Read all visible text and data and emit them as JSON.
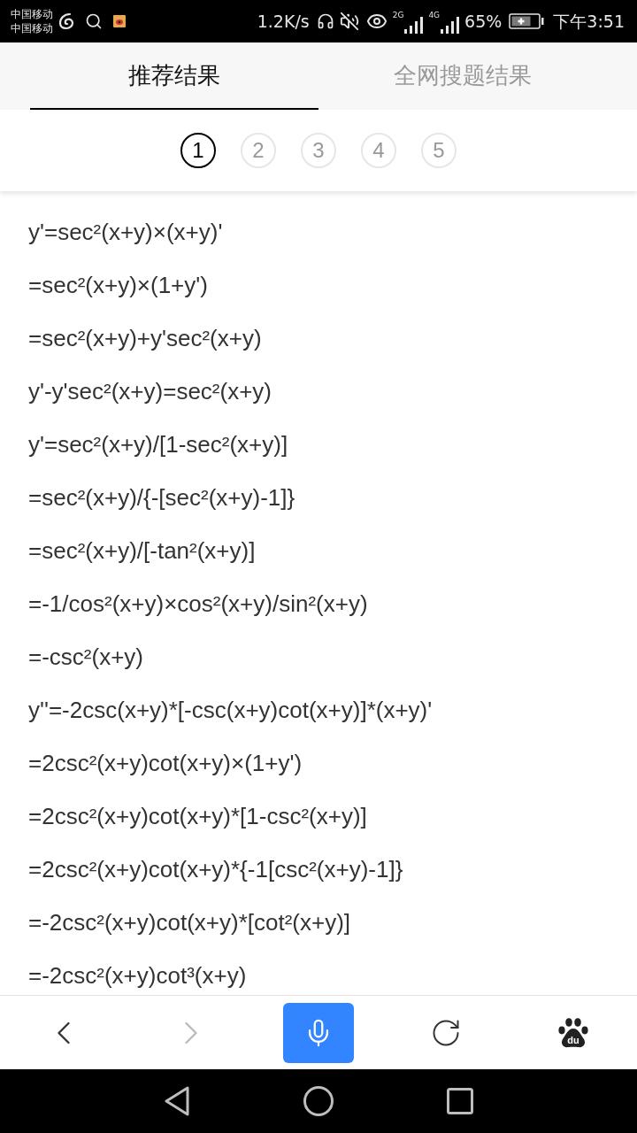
{
  "status_bar": {
    "carriers": [
      "中国移动",
      "中国移动"
    ],
    "speed": "1.2K/s",
    "networks": [
      "2G",
      "4G"
    ],
    "battery": "65%",
    "time": "下午3:51"
  },
  "tabs": [
    {
      "label": "推荐结果",
      "selected": true
    },
    {
      "label": "全网搜题结果",
      "selected": false
    }
  ],
  "pagination": [
    {
      "label": "1",
      "selected": true
    },
    {
      "label": "2",
      "selected": false
    },
    {
      "label": "3",
      "selected": false
    },
    {
      "label": "4",
      "selected": false
    },
    {
      "label": "5",
      "selected": false
    }
  ],
  "solution_lines": [
    "y'=sec²(x+y)×(x+y)'",
    "=sec²(x+y)×(1+y')",
    "=sec²(x+y)+y'sec²(x+y)",
    "y'-y'sec²(x+y)=sec²(x+y)",
    "y'=sec²(x+y)/[1-sec²(x+y)]",
    "=sec²(x+y)/{-[sec²(x+y)-1]}",
    "=sec²(x+y)/[-tan²(x+y)]",
    "=-1/cos²(x+y)×cos²(x+y)/sin²(x+y)",
    "=-csc²(x+y)",
    "y''=-2csc(x+y)*[-csc(x+y)cot(x+y)]*(x+y)'",
    "=2csc²(x+y)cot(x+y)×(1+y')",
    "=2csc²(x+y)cot(x+y)*[1-csc²(x+y)]",
    "=2csc²(x+y)cot(x+y)*{-1[csc²(x+y)-1]}",
    "=-2csc²(x+y)cot(x+y)*[cot²(x+y)]",
    "=-2csc²(x+y)cot³(x+y)"
  ],
  "toolbar": [
    {
      "kind": "back",
      "disabled": false
    },
    {
      "kind": "forward",
      "disabled": true
    },
    {
      "kind": "voice"
    },
    {
      "kind": "refresh",
      "disabled": false
    },
    {
      "kind": "paw",
      "label": "du"
    }
  ]
}
